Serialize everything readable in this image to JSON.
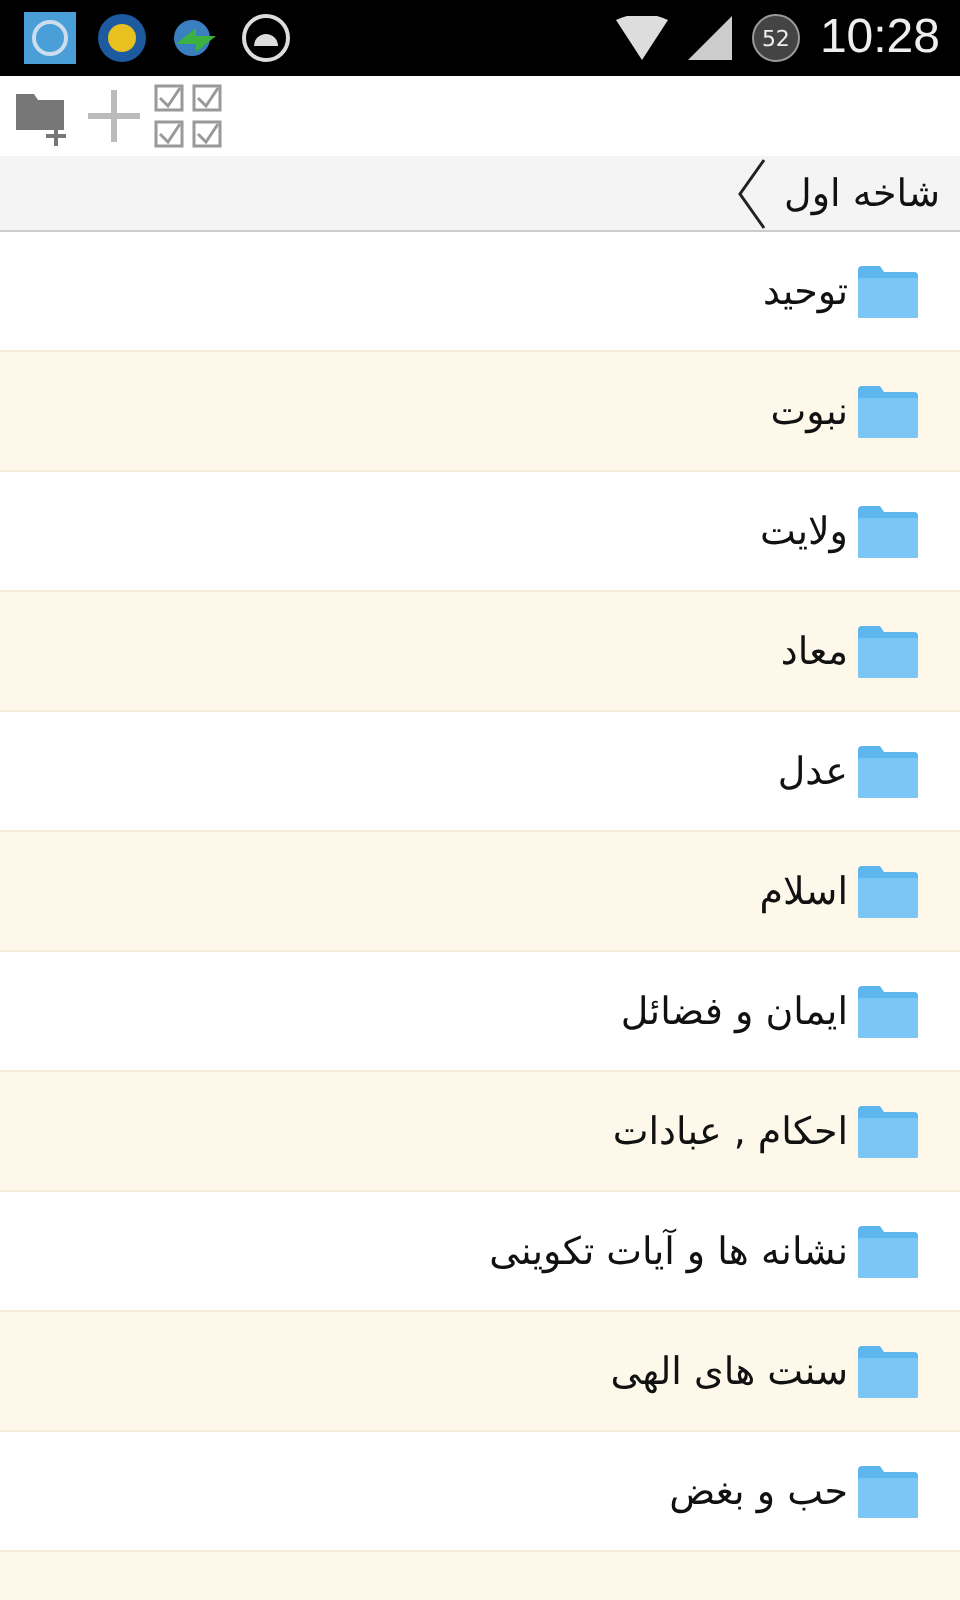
{
  "status_bar": {
    "time": "10:28",
    "badge": "52"
  },
  "breadcrumb": {
    "title": "شاخه اول"
  },
  "folders": [
    {
      "label": "توحید"
    },
    {
      "label": "نبوت"
    },
    {
      "label": "ولایت"
    },
    {
      "label": "معاد"
    },
    {
      "label": "عدل"
    },
    {
      "label": "اسلام"
    },
    {
      "label": "ایمان و فضائل"
    },
    {
      "label": "احکام , عبادات"
    },
    {
      "label": "نشانه ها و آیات تکوینی"
    },
    {
      "label": "سنت های الهی"
    },
    {
      "label": "حب و بغض"
    }
  ]
}
